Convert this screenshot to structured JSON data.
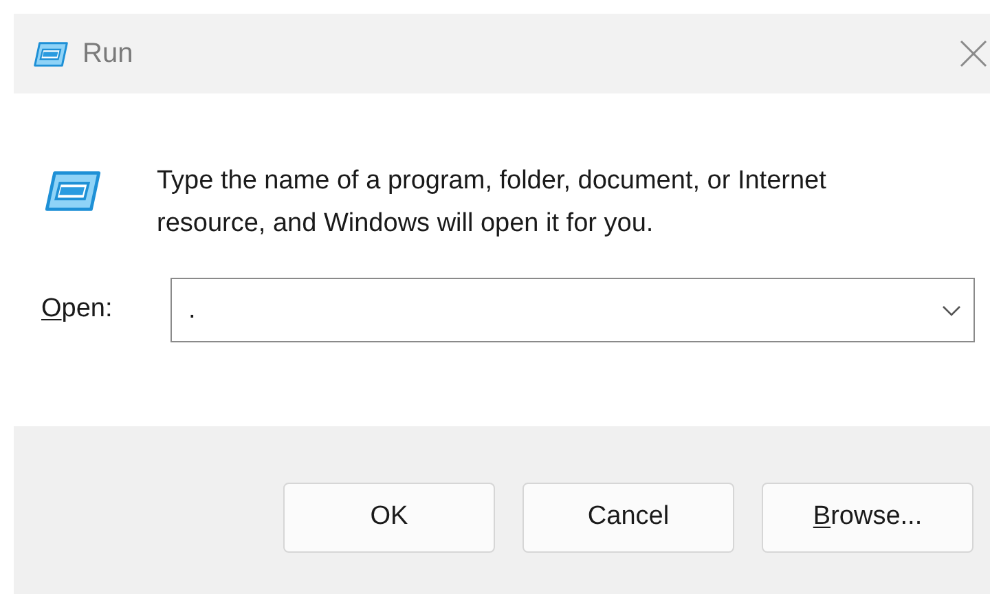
{
  "window": {
    "title": "Run"
  },
  "message": "Type the name of a program, folder, document, or Internet resource, and Windows will open it for you.",
  "open_field": {
    "label": "Open:",
    "mnemonic": true,
    "value": "."
  },
  "buttons": [
    {
      "label": "OK",
      "mnemonic": false
    },
    {
      "label": "Cancel",
      "mnemonic": false
    },
    {
      "label": "Browse...",
      "mnemonic": true
    }
  ]
}
